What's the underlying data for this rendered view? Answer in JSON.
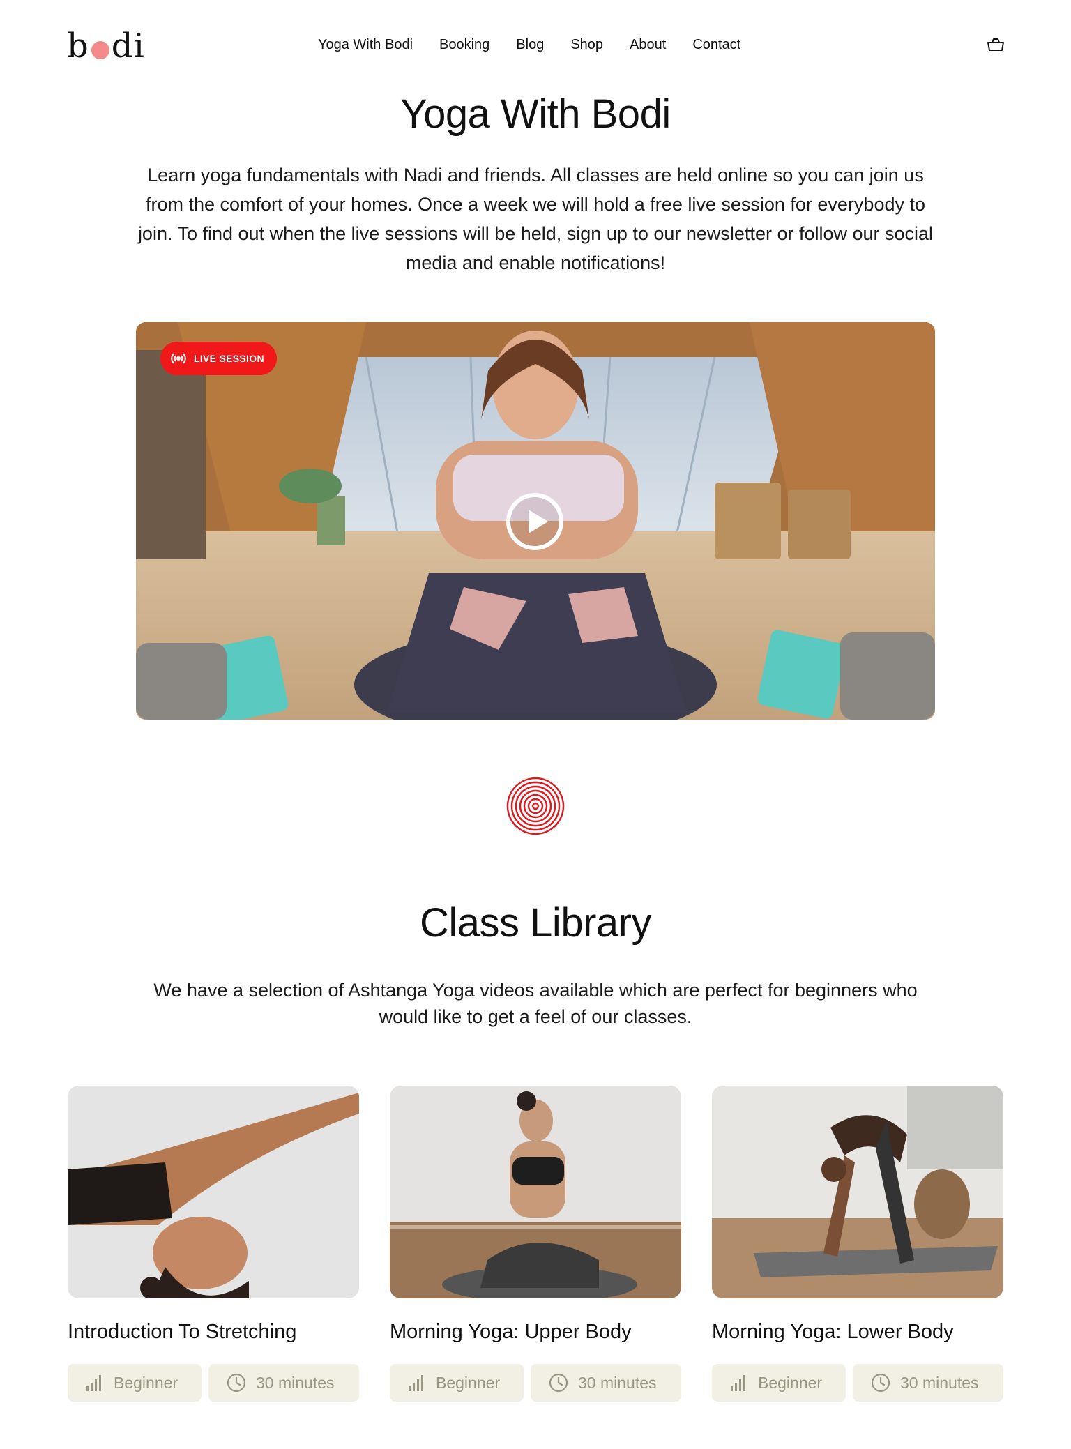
{
  "brand": {
    "logo_left": "b",
    "logo_right": "di",
    "logo_dot_color": "#f48a8a"
  },
  "nav": {
    "items": [
      "Yoga With Bodi",
      "Booking",
      "Blog",
      "Shop",
      "About",
      "Contact"
    ],
    "cart_icon": "shopping-basket-icon"
  },
  "intro": {
    "title": "Yoga With Bodi",
    "text": "Learn yoga fundamentals with Nadi and friends. All classes are held online so you can join us from the comfort of your homes. Once a week we will hold a free live session for everybody to join. To find out when the live sessions will be held, sign up to our newsletter or follow our social media and enable notifications!"
  },
  "video": {
    "badge_label": "LIVE SESSION",
    "badge_icon": "broadcast-icon",
    "badge_color": "#f01818",
    "play_icon": "play-circle-icon"
  },
  "divider": {
    "icon": "spiral-icon",
    "color": "#e0191f"
  },
  "library": {
    "title": "Class Library",
    "description": "We have a selection of Ashtanga Yoga videos available which are perfect for beginners who would like to get a feel of our classes.",
    "cards": [
      {
        "title": "Introduction To Stretching",
        "level": "Beginner",
        "duration": "30 minutes"
      },
      {
        "title": "Morning Yoga: Upper Body",
        "level": "Beginner",
        "duration": "30 minutes"
      },
      {
        "title": "Morning Yoga: Lower Body",
        "level": "Beginner",
        "duration": "30 minutes"
      }
    ],
    "tag_background": "#f2efe5",
    "tag_text_color": "#9b9682"
  }
}
